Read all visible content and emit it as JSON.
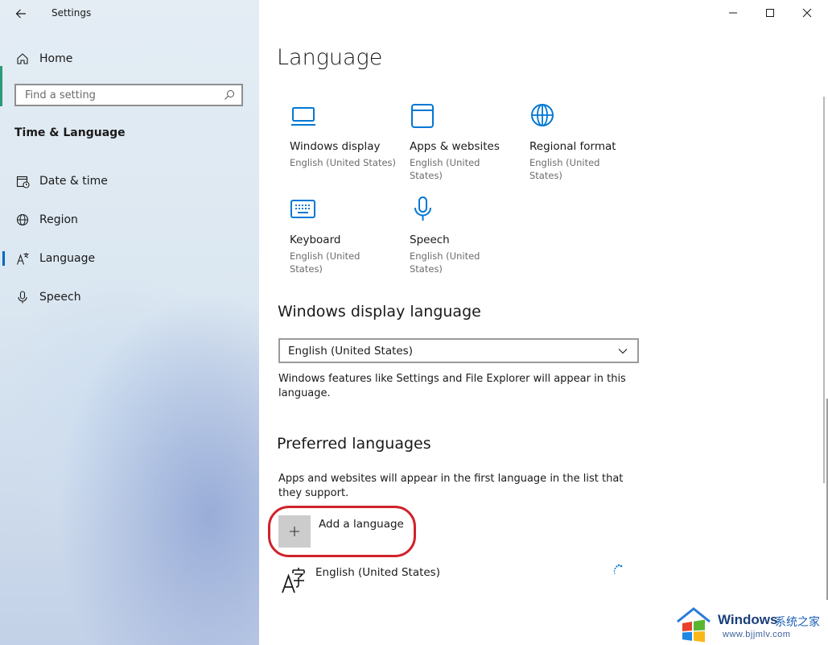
{
  "window": {
    "title": "Settings",
    "controls": {
      "minimize": "minimize-icon",
      "maximize": "maximize-icon",
      "close": "close-icon"
    }
  },
  "sidebar": {
    "home_label": "Home",
    "search": {
      "placeholder": "Find a setting",
      "value": ""
    },
    "section_heading": "Time & Language",
    "items": [
      {
        "label": "Date & time",
        "icon": "calendar-clock-icon",
        "selected": false
      },
      {
        "label": "Region",
        "icon": "globe-icon",
        "selected": false
      },
      {
        "label": "Language",
        "icon": "language-icon",
        "selected": true
      },
      {
        "label": "Speech",
        "icon": "microphone-icon",
        "selected": false
      }
    ]
  },
  "main": {
    "page_title": "Language",
    "tiles": [
      {
        "title": "Windows display",
        "subtitle": "English (United States)",
        "icon": "display-icon"
      },
      {
        "title": "Apps & websites",
        "subtitle": "English (United States)",
        "icon": "window-icon"
      },
      {
        "title": "Regional format",
        "subtitle": "English (United States)",
        "icon": "globe-icon"
      },
      {
        "title": "Keyboard",
        "subtitle": "English (United States)",
        "icon": "keyboard-icon"
      },
      {
        "title": "Speech",
        "subtitle": "English (United States)",
        "icon": "microphone-icon"
      }
    ],
    "display_language": {
      "heading": "Windows display language",
      "selected": "English (United States)",
      "description": "Windows features like Settings and File Explorer will appear in this language."
    },
    "preferred": {
      "heading": "Preferred languages",
      "description": "Apps and websites will appear in the first language in the list that they support.",
      "add_label": "Add a language",
      "languages": [
        {
          "name": "English (United States)"
        }
      ]
    }
  },
  "watermark": {
    "brand": "Windows",
    "cn_text": "系统之家",
    "url": "www.bjjmlv.com"
  },
  "colors": {
    "accent": "#0067c0",
    "icon_blue": "#0078d4",
    "highlight_ring": "#d0222b",
    "plus_box": "#cccccc"
  }
}
